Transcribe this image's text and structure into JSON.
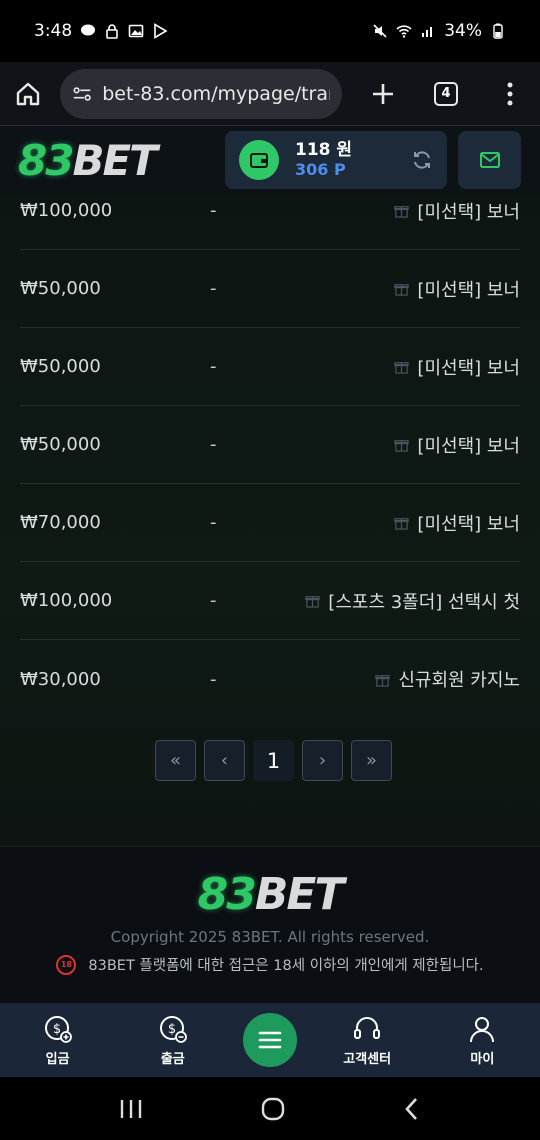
{
  "status": {
    "time": "3:48",
    "battery": "34%"
  },
  "browser": {
    "url": "bet-83.com/mypage/trans",
    "tab_count": "4"
  },
  "header": {
    "logo_num": "83",
    "logo_text": "BET",
    "wallet_money": "118 원",
    "wallet_point": "306 P"
  },
  "rows": [
    {
      "amount": "₩100,000",
      "dash": "-",
      "desc": "[미선택] 보너"
    },
    {
      "amount": "₩50,000",
      "dash": "-",
      "desc": "[미선택] 보너"
    },
    {
      "amount": "₩50,000",
      "dash": "-",
      "desc": "[미선택] 보너"
    },
    {
      "amount": "₩50,000",
      "dash": "-",
      "desc": "[미선택] 보너"
    },
    {
      "amount": "₩70,000",
      "dash": "-",
      "desc": "[미선택] 보너"
    },
    {
      "amount": "₩100,000",
      "dash": "-",
      "desc": "[스포츠 3폴더] 선택시 첫"
    },
    {
      "amount": "₩30,000",
      "dash": "-",
      "desc": "신규회원 카지노"
    }
  ],
  "pager": {
    "first": "«",
    "prev": "‹",
    "current": "1",
    "next": "›",
    "last": "»"
  },
  "footer": {
    "copyright": "Copyright 2025 83BET. All rights reserved.",
    "age_badge": "18",
    "age_note": "83BET 플랫폼에 대한 접근은 18세 이하의 개인에게 제한됩니다."
  },
  "nav": {
    "deposit": "입금",
    "withdraw": "출금",
    "support": "고객센터",
    "my": "마이"
  },
  "colors": {
    "accent": "#2ec866",
    "point": "#4d8df0",
    "nav_bg": "#1b2738"
  }
}
